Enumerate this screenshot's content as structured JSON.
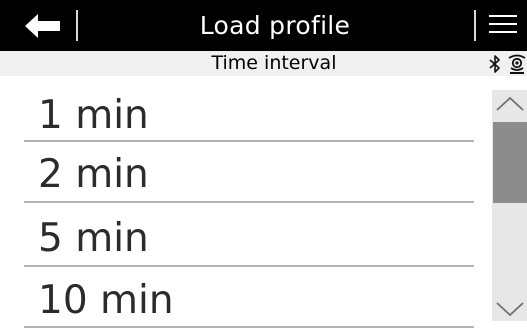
{
  "header": {
    "title": "Load profile",
    "back_icon": "back-arrow-icon",
    "menu_icon": "hamburger-menu-icon"
  },
  "subheader": {
    "title": "Time interval",
    "status_icons": [
      "bluetooth-icon",
      "signal-icon"
    ]
  },
  "list": {
    "items": [
      {
        "label": "1 min"
      },
      {
        "label": "2 min"
      },
      {
        "label": "5 min"
      },
      {
        "label": "10 min"
      }
    ]
  },
  "scrollbar": {
    "up_icon": "chevron-up-icon",
    "down_icon": "chevron-down-icon",
    "position": 0.15
  },
  "colors": {
    "header_bg": "#000000",
    "header_text": "#ffffff",
    "subheader_bg": "#f0f0f0",
    "divider": "#b4b4b4",
    "item_text": "#2b2b2b",
    "scrollbar_track": "#e7e7e7",
    "scrollbar_thumb": "#8c8c8c"
  }
}
